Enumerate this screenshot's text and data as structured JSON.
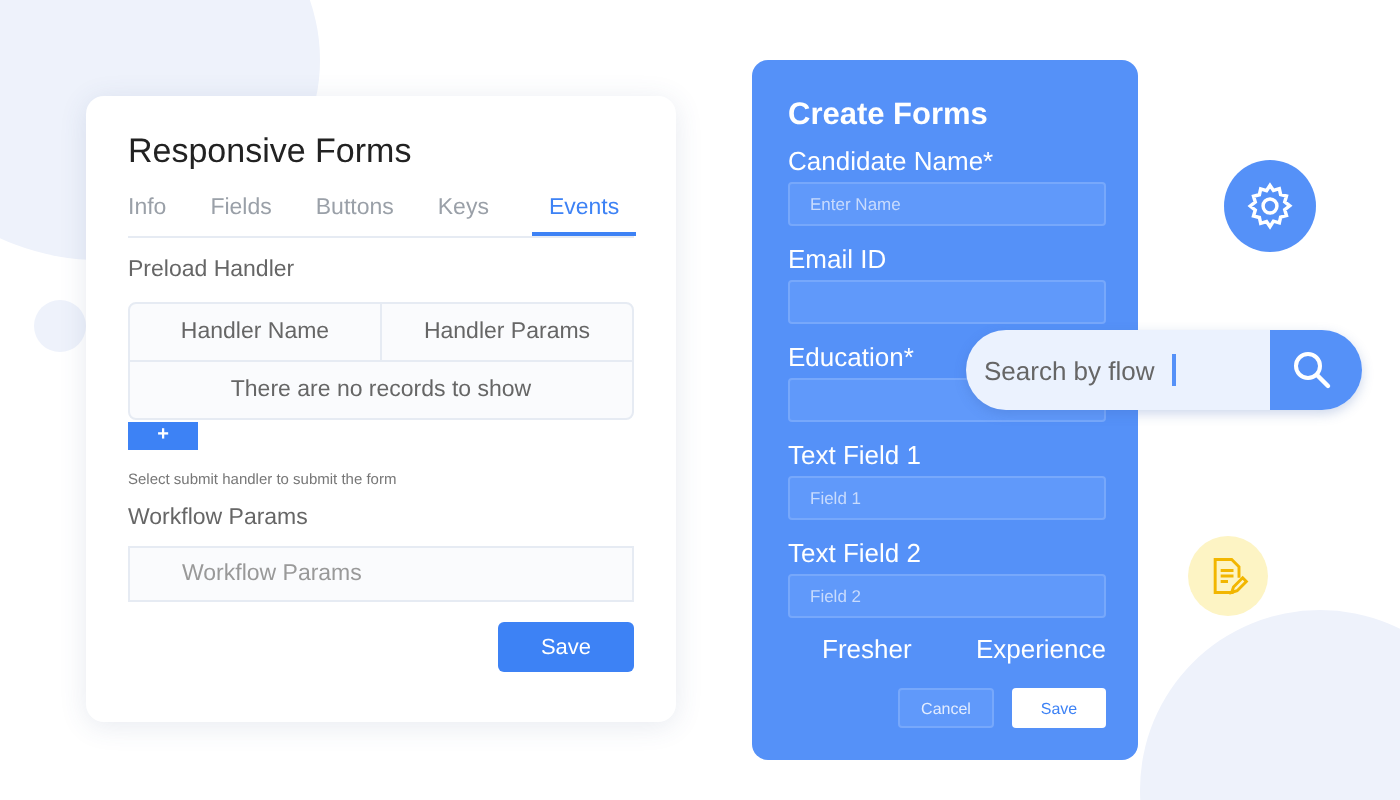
{
  "settings_card": {
    "title": "Responsive Forms",
    "tabs": [
      {
        "label": "Info",
        "selected": false
      },
      {
        "label": "Fields",
        "selected": false
      },
      {
        "label": "Buttons",
        "selected": false
      },
      {
        "label": "Keys",
        "selected": false
      },
      {
        "label": "Events",
        "selected": true
      }
    ],
    "preload_handler": {
      "label": "Preload Handler",
      "columns": [
        "Handler Name",
        "Handler Params"
      ],
      "empty_message": "There are no records to show",
      "add_button": "+"
    },
    "hint": "Select submit handler to submit the form",
    "workflow_params": {
      "label": "Workflow Params",
      "placeholder": "Workflow Params"
    },
    "save_button": "Save"
  },
  "create_form": {
    "title": "Create Forms",
    "fields": [
      {
        "label": "Candidate Name*",
        "placeholder": "Enter Name"
      },
      {
        "label": "Email ID"
      },
      {
        "label": "Education*"
      },
      {
        "label": "Text Field 1",
        "placeholder": "Field 1"
      },
      {
        "label": "Text Field 2",
        "placeholder": "Field 2"
      }
    ],
    "options": [
      "Fresher",
      "Experience"
    ],
    "cancel_button": "Cancel",
    "save_button": "Save"
  },
  "search": {
    "value": "Search by flow"
  }
}
